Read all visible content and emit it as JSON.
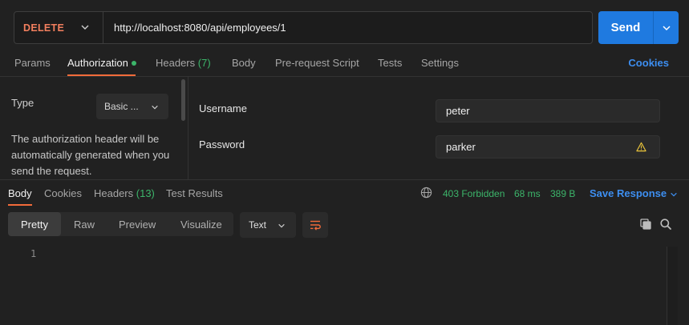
{
  "request": {
    "method": "DELETE",
    "url": "http://localhost:8080/api/employees/1",
    "send_label": "Send"
  },
  "request_tabs": {
    "params": "Params",
    "authorization": "Authorization",
    "headers": "Headers",
    "headers_count": "(7)",
    "body": "Body",
    "pre_request": "Pre-request Script",
    "tests": "Tests",
    "settings": "Settings",
    "cookies": "Cookies"
  },
  "auth": {
    "type_label": "Type",
    "type_value": "Basic ...",
    "description": "The authorization header will be automatically generated when you send the request.",
    "username_label": "Username",
    "username_value": "peter",
    "password_label": "Password",
    "password_value": "parker"
  },
  "response": {
    "tabs": {
      "body": "Body",
      "cookies": "Cookies",
      "headers": "Headers",
      "headers_count": "(13)",
      "test_results": "Test Results"
    },
    "status": "403 Forbidden",
    "time": "68 ms",
    "size": "389 B",
    "save_label": "Save Response",
    "formats": {
      "pretty": "Pretty",
      "raw": "Raw",
      "preview": "Preview",
      "visualize": "Visualize"
    },
    "content_type": "Text",
    "line_number": "1"
  },
  "colors": {
    "accent": "#f26b3a",
    "primary": "#1f7ae0",
    "success": "#3cb56a",
    "method_delete": "#f27f5e",
    "warning": "#e8c33a"
  }
}
